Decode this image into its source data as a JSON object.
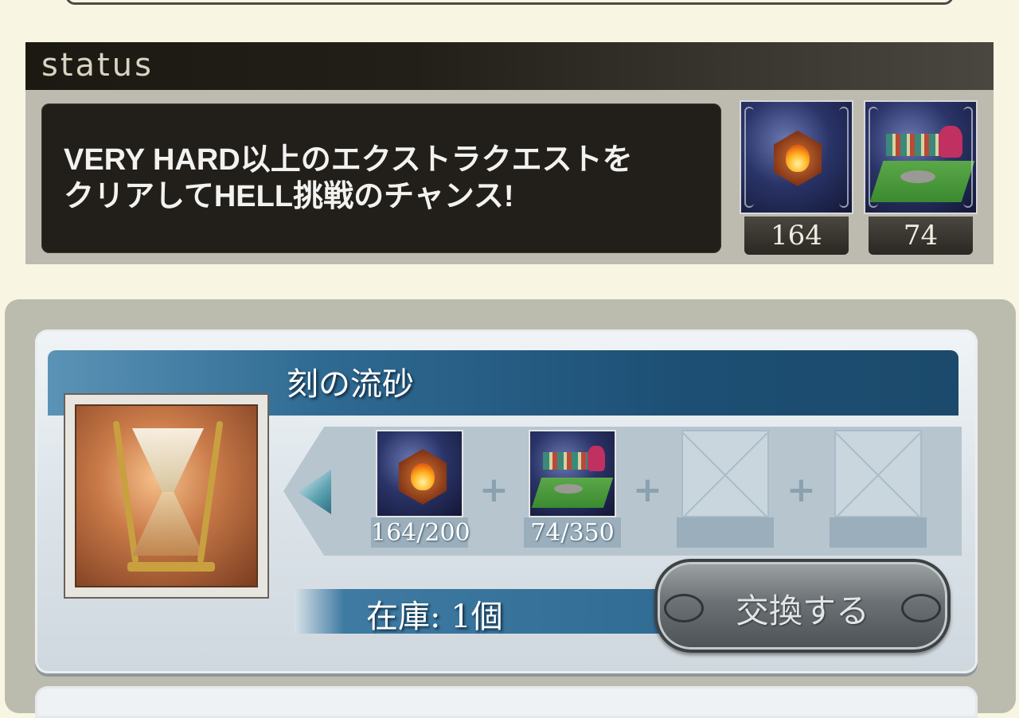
{
  "status": {
    "title": "status",
    "message_line1": "VERY HARD以上のエクストラクエストを",
    "message_line2": "クリアしてHELL挑戦のチャンス!",
    "items": [
      {
        "icon": "fire-medal-icon",
        "count": "164"
      },
      {
        "icon": "kitchenware-icon",
        "count": "74"
      }
    ]
  },
  "exchange": {
    "item_name": "刻の流砂",
    "reward_icon": "hourglass-icon",
    "materials": [
      {
        "icon": "fire-medal-icon",
        "count": "164/200"
      },
      {
        "icon": "kitchenware-icon",
        "count": "74/350"
      },
      {
        "icon": "empty-slot-icon",
        "count": ""
      },
      {
        "icon": "empty-slot-icon",
        "count": ""
      }
    ],
    "plus_sign": "+",
    "stock_label": "在庫: 1個",
    "button_label": "交換する"
  }
}
